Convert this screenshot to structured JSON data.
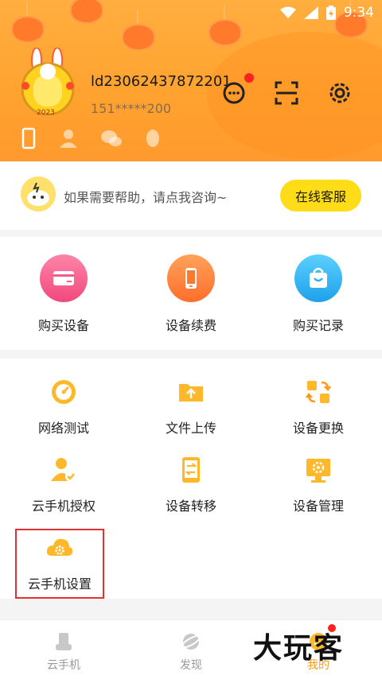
{
  "status_bar": {
    "time": "9:34"
  },
  "profile": {
    "username": "ld23062437872201",
    "phone": "151*****200",
    "avatar_year": "2023"
  },
  "help": {
    "text": "如果需要帮助，请点我咨询~",
    "button_label": "在线客服"
  },
  "top_actions": [
    {
      "label": "购买设备",
      "icon": "card-icon",
      "color": "#f25b8a"
    },
    {
      "label": "设备续费",
      "icon": "phone-icon",
      "color": "#ff7a2e"
    },
    {
      "label": "购买记录",
      "icon": "bag-icon",
      "color": "#2cb4f0"
    }
  ],
  "tools": [
    {
      "label": "网络测试",
      "icon": "speedometer-icon"
    },
    {
      "label": "文件上传",
      "icon": "upload-folder-icon"
    },
    {
      "label": "设备更换",
      "icon": "swap-icon"
    },
    {
      "label": "云手机授权",
      "icon": "user-check-icon"
    },
    {
      "label": "设备转移",
      "icon": "transfer-icon"
    },
    {
      "label": "设备管理",
      "icon": "monitor-gear-icon"
    },
    {
      "label": "云手机设置",
      "icon": "cloud-gear-icon"
    }
  ],
  "tabbar": [
    {
      "label": "云手机",
      "icon": "cloud-phone-icon",
      "active": false
    },
    {
      "label": "发现",
      "icon": "planet-icon",
      "active": false
    },
    {
      "label": "我的",
      "icon": "me-icon",
      "active": true
    }
  ],
  "watermark": "大玩客",
  "colors": {
    "accent": "#ffa41c",
    "button": "#ffdc18",
    "highlight_box": "#e23131"
  }
}
